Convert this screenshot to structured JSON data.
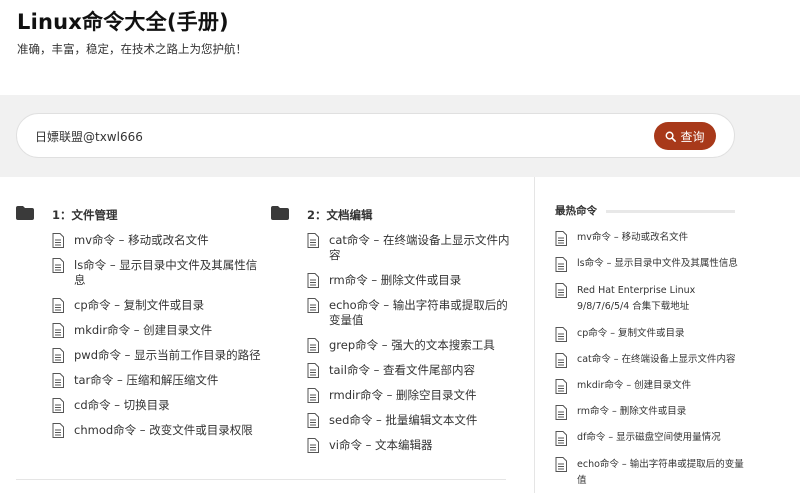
{
  "site": {
    "title": "Linux命令大全(手册)",
    "slogan": "准确，丰富，稳定，在技术之路上为您护航！"
  },
  "search": {
    "value": "日嫖联盟@txwl666",
    "button_label": "查询"
  },
  "categories": [
    {
      "title": "1：文件管理",
      "items": [
        "mv命令 – 移动或改名文件",
        "ls命令 – 显示目录中文件及其属性信息",
        "cp命令 – 复制文件或目录",
        "mkdir命令 – 创建目录文件",
        "pwd命令 – 显示当前工作目录的路径",
        "tar命令 – 压缩和解压缩文件",
        "cd命令 – 切换目录",
        "chmod命令 – 改变文件或目录权限"
      ]
    },
    {
      "title": "2：文档编辑",
      "items": [
        "cat命令 – 在终端设备上显示文件内容",
        "rm命令 – 删除文件或目录",
        "echo命令 – 输出字符串或提取后的变量值",
        "grep命令 – 强大的文本搜索工具",
        "tail命令 – 查看文件尾部内容",
        "rmdir命令 – 删除空目录文件",
        "sed命令 – 批量编辑文本文件",
        "vi命令 – 文本编辑器"
      ]
    }
  ],
  "sidebar": {
    "title": "最热命令",
    "items": [
      "mv命令 – 移动或改名文件",
      "ls命令 – 显示目录中文件及其属性信息",
      "Red Hat Enterprise Linux 9/8/7/6/5/4 合集下载地址",
      "cp命令 – 复制文件或目录",
      "cat命令 – 在终端设备上显示文件内容",
      "mkdir命令 – 创建目录文件",
      "rm命令 – 删除文件或目录",
      "df命令 – 显示磁盘空间使用量情况",
      "echo命令 – 输出字符串或提取后的变量值"
    ]
  },
  "colors": {
    "accent": "#a8391a",
    "band": "#f1f1f1"
  }
}
